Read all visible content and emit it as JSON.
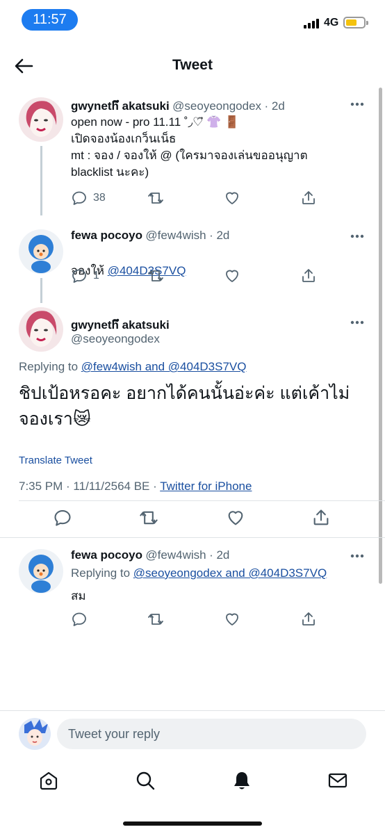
{
  "status_bar": {
    "time": "11:57",
    "network": "4G"
  },
  "header": {
    "title": "Tweet"
  },
  "tweet1": {
    "name": "gwynethึ akatsuki",
    "handle": "@seoyeongodex",
    "time": "· 2d",
    "text": "open now - pro 11.11 ˚◞♡⃗ 👚 🚪\nเปิดจองน้องเกว็นเน็ธ\nmt : จอง / จองให้ @ (ใครมาจองเล่นขออนุญาต\nblacklist นะคะ)",
    "reply_count": "38"
  },
  "tweet2": {
    "name": "fewa pocoyo",
    "handle": "@few4wish",
    "time": "· 2d",
    "text_prefix": "จองให้ ",
    "mention": "@404D3S7VQ",
    "reply_count": "1"
  },
  "main_tweet": {
    "name": "gwynethึ akatsuki",
    "handle": "@seoyeongodex",
    "replying_label": "Replying to",
    "replying_to": "@few4wish and @404D3S7VQ",
    "text": "ชิปเป้อหรอคะ อยากได้คนนั้นอ่ะค่ะ แต่เค้าไม่จองเรา😿",
    "translate": "Translate Tweet",
    "timestamp": "7:35 PM · 11/11/2564 BE · ",
    "source": "Twitter for iPhone"
  },
  "tweet3": {
    "name": "fewa pocoyo",
    "handle": "@few4wish",
    "time": "· 2d",
    "replying_label": "Replying to",
    "replying_to": "@seoyeongodex and @404D3S7VQ",
    "text": "สม"
  },
  "reply_bar": {
    "placeholder": "Tweet your reply"
  },
  "colors": {
    "accent": "#1d7cf0",
    "link": "#1a4fa0",
    "muted": "#536471"
  }
}
